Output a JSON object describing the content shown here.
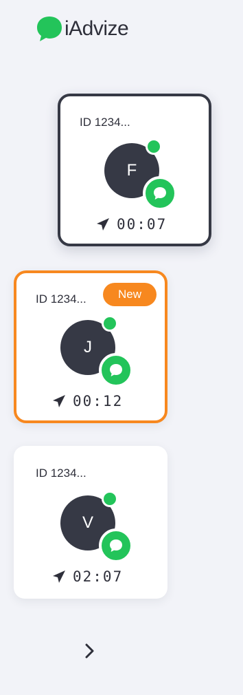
{
  "app": {
    "name": "iAdvize",
    "brand_color": "#23c45a"
  },
  "conversations": [
    {
      "id_label": "ID 1234...",
      "initial": "F",
      "timer": "00:07",
      "state": "active",
      "badge": null,
      "online": true,
      "channel": "chat"
    },
    {
      "id_label": "ID 1234...",
      "initial": "J",
      "timer": "00:12",
      "state": "new",
      "badge": "New",
      "online": true,
      "channel": "chat"
    },
    {
      "id_label": "ID 1234...",
      "initial": "V",
      "timer": "02:07",
      "state": "default",
      "badge": null,
      "online": true,
      "channel": "chat"
    }
  ],
  "colors": {
    "active_border": "#363945",
    "new_border": "#f7881f",
    "online": "#23c45a",
    "avatar": "#363945"
  },
  "icons": {
    "logo": "speech-bubble-logo-icon",
    "timer": "paper-plane-icon",
    "channel": "chat-bubble-icon",
    "next": "chevron-right-icon"
  }
}
